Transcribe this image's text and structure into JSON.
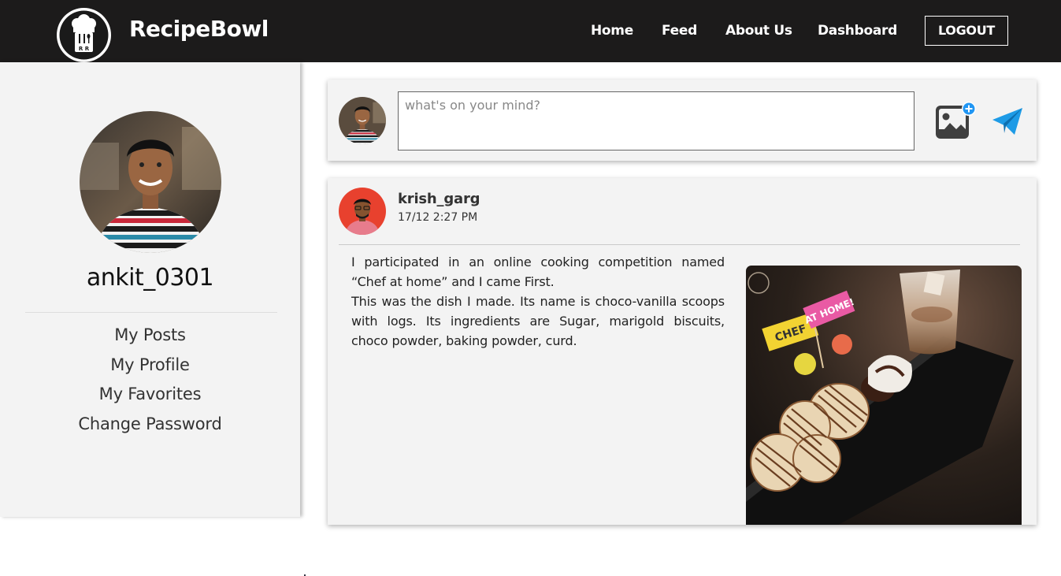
{
  "app": {
    "brand": "RecipeBowl",
    "logo_initials": "R R"
  },
  "nav": {
    "items": [
      {
        "label": "Home"
      },
      {
        "label": "Feed"
      },
      {
        "label": "About Us"
      },
      {
        "label": "Dashboard"
      }
    ],
    "logout_label": "LOGOUT"
  },
  "sidebar": {
    "username": "ankit_0301",
    "menu": [
      {
        "label": "My Posts"
      },
      {
        "label": "My Profile"
      },
      {
        "label": "My Favorites"
      },
      {
        "label": "Change Password"
      }
    ]
  },
  "composer": {
    "placeholder": "what's on your mind?",
    "add_image_icon": "add-image-icon",
    "send_icon": "paper-plane-icon"
  },
  "post": {
    "author": "krish_garg",
    "timestamp": "17/12 2:27 PM",
    "paragraphs": [
      "I participated in an online cooking competition named “Chef at home” and I came First.",
      "This was the dish I made. Its name is choco-vanilla scoops with logs. Its ingredients are Sugar, marigold biscuits, choco powder, baking powder, curd."
    ],
    "image_sign_text": "CHEF AT HOME!"
  },
  "colors": {
    "header_bg": "#1c1b1b",
    "panel_bg": "#f3f3f3",
    "send_accent": "#1e9be6",
    "add_badge": "#2196f3"
  }
}
